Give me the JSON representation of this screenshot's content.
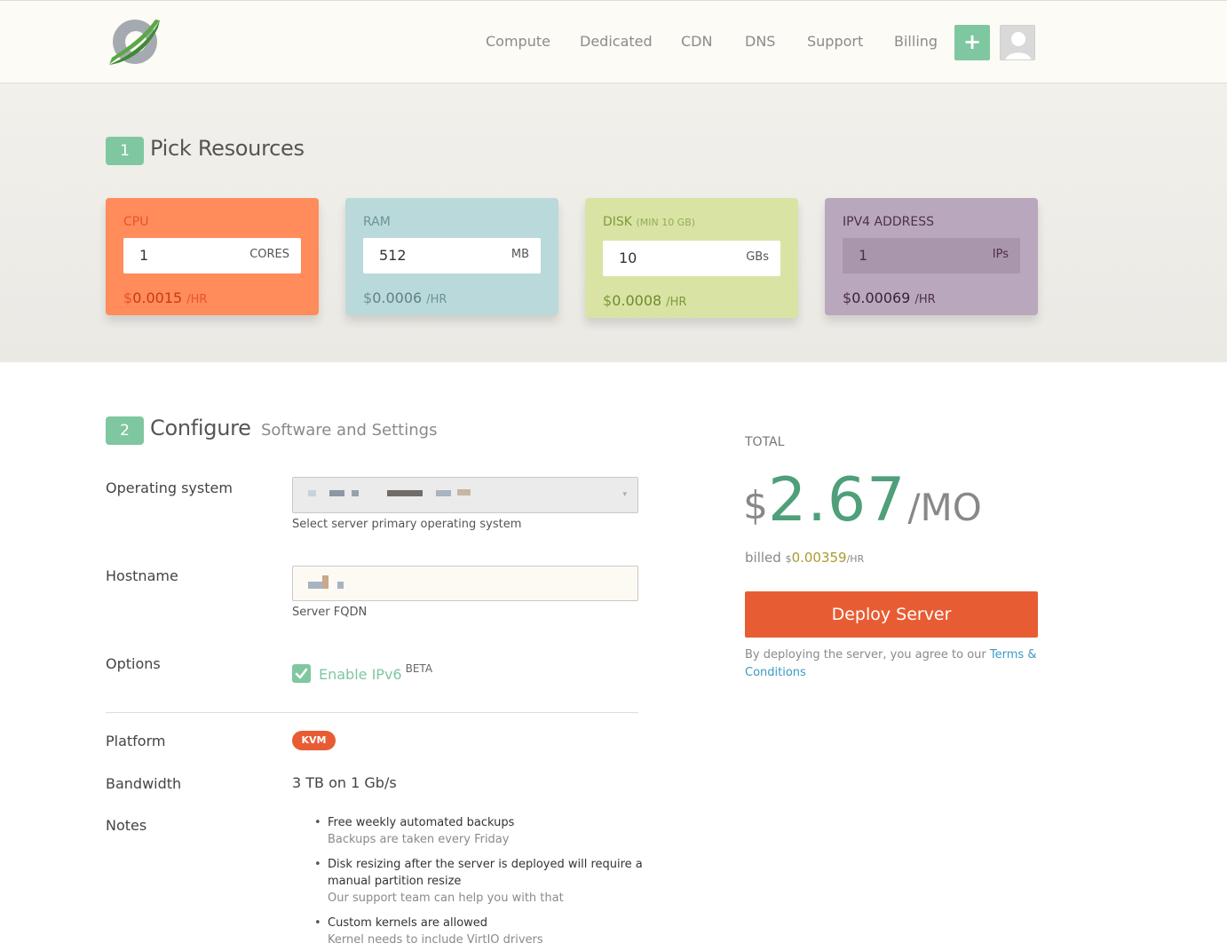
{
  "nav": {
    "items": [
      "Compute",
      "Dedicated",
      "CDN",
      "DNS",
      "Support",
      "Billing"
    ],
    "add_label": "+"
  },
  "section1": {
    "step": "1",
    "title": "Pick Resources"
  },
  "cards": {
    "cpu": {
      "title": "CPU",
      "value": "1",
      "unit": "CORES",
      "currency": "$",
      "price": "0.0015",
      "per": "/HR",
      "bg": "#ff8c5a",
      "text": "#e8522e"
    },
    "ram": {
      "title": "RAM",
      "value": "512",
      "unit": "MB",
      "currency": "$",
      "price": "0.0006",
      "per": "/HR",
      "bg": "#bad9da",
      "text": "#6b9497"
    },
    "disk": {
      "title": "DISK",
      "title_note": "(MIN 10 GB)",
      "value": "10",
      "unit": "GBs",
      "currency": "$",
      "price": "0.0008",
      "per": "/HR",
      "bg": "#d9e4a4",
      "text": "#7e9a3b"
    },
    "ipv4": {
      "title": "IPV4 ADDRESS",
      "value": "1",
      "unit": "IPs",
      "currency": "$",
      "price": "0.00069",
      "per": "/HR",
      "bg": "#b9a7bd",
      "text": "#4d2f4e"
    }
  },
  "section2": {
    "step": "2",
    "title": "Configure",
    "subtitle": "Software and Settings"
  },
  "form": {
    "os_label": "Operating system",
    "os_help": "Select server primary operating system",
    "hostname_label": "Hostname",
    "hostname_help": "Server FQDN",
    "options_label": "Options",
    "ipv6_label": "Enable IPv6",
    "ipv6_badge": "BETA",
    "platform_label": "Platform",
    "platform_value": "KVM",
    "bandwidth_label": "Bandwidth",
    "bandwidth_value": "3 TB on 1 Gb/s",
    "notes_label": "Notes",
    "notes": [
      {
        "text": "Free weekly automated backups",
        "sub": "Backups are taken every Friday"
      },
      {
        "text": "Disk resizing after the server is deployed will require a manual partition resize",
        "sub": "Our support team can help you with that"
      },
      {
        "text": "Custom kernels are allowed",
        "sub": "Kernel needs to include VirtIO drivers"
      }
    ]
  },
  "total": {
    "label": "TOTAL",
    "currency": "$",
    "amount": "2.67",
    "per": "/MO",
    "billed_prefix": "billed",
    "billed_currency": "$",
    "billed_amount": "0.00359",
    "billed_per": "/HR",
    "deploy_label": "Deploy Server",
    "agree_text": "By deploying the server, you agree to our",
    "terms_link": "Terms & Conditions"
  },
  "colors": {
    "accent_green": "#7fc7a0",
    "deploy_orange": "#e85c33",
    "price_green": "#4f9f7a",
    "link_blue": "#3a9bc5"
  }
}
